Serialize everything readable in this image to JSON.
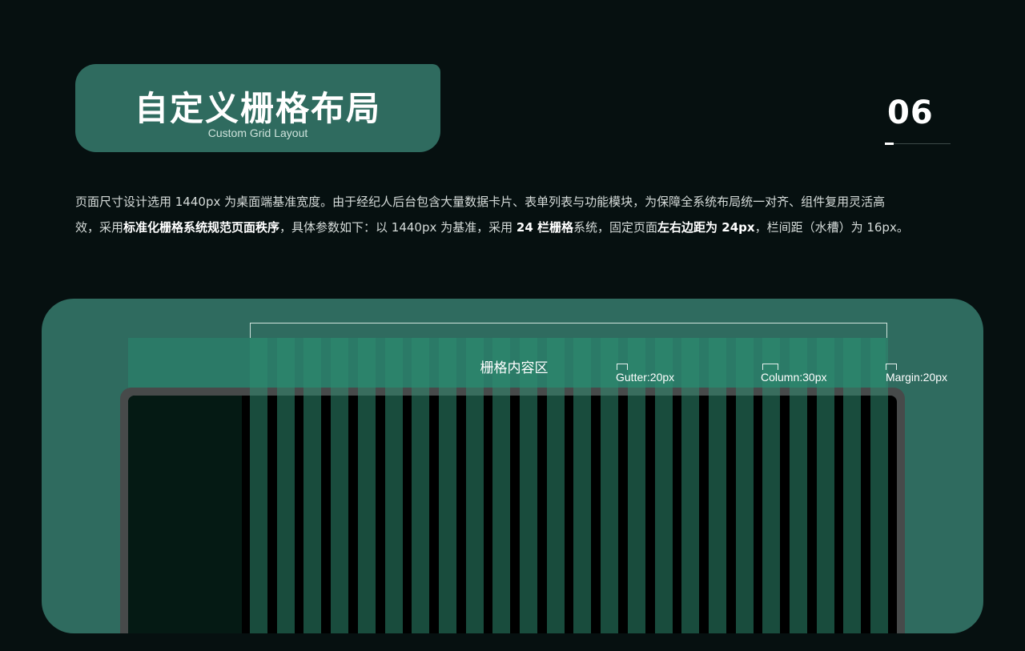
{
  "header": {
    "title": "自定义栅格布局",
    "subtitle": "Custom Grid Layout",
    "page_number": "06"
  },
  "intro": {
    "line1": "页面尺寸设计选用 1440px 为桌面端基准宽度。由于经纪人后台包含大量数据卡片、表单列表与功能模块，为保障全系统布局统一对齐、组件复用灵活高",
    "line2_a": "效，采用",
    "line2_b": "标准化栅格系统规范页面秩序",
    "line2_c": "，具体参数如下：以 1440px 为基准，采用 ",
    "line2_d": "24 栏栅格",
    "line2_e": "系统，固定页面",
    "line2_f": "左右边距为 24px",
    "line2_g": "，栏间距（水槽）为 16px。"
  },
  "diagram": {
    "area_label": "栅格内容区",
    "legend": [
      {
        "label": "Gutter:20px",
        "icon": "bracket-icon"
      },
      {
        "label": "Column:30px",
        "icon": "bracket-icon"
      },
      {
        "label": "Margin:20px",
        "icon": "bracket-icon"
      }
    ]
  },
  "colors": {
    "background": "#061010",
    "pill": "#2f6b5f",
    "stage": "#2f6b5f",
    "grid_column": "#2e8a70",
    "device_frame": "#474a4a"
  }
}
